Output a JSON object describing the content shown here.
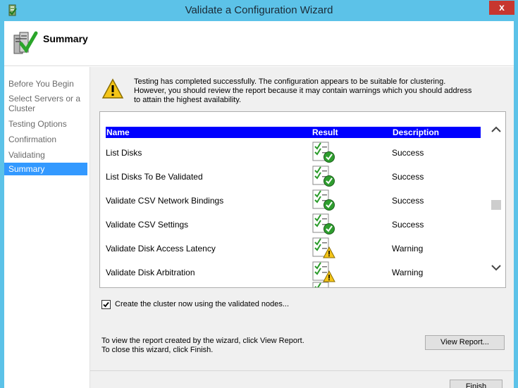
{
  "window": {
    "title": "Validate a Configuration Wizard",
    "close_label": "x"
  },
  "header": {
    "title": "Summary",
    "icon": "cluster-validation-icon"
  },
  "nav": {
    "items": [
      {
        "label": "Before You Begin"
      },
      {
        "label": "Select Servers or a Cluster"
      },
      {
        "label": "Testing Options"
      },
      {
        "label": "Confirmation"
      },
      {
        "label": "Validating"
      },
      {
        "label": "Summary",
        "active": true
      }
    ]
  },
  "info": {
    "icon": "warning-icon",
    "text_line1": "Testing has completed successfully. The configuration appears to be suitable for clustering.",
    "text_line2": "However, you should review the report because it may contain warnings which you should address",
    "text_line3": "to attain the highest availability."
  },
  "report": {
    "columns": {
      "name": "Name",
      "result": "Result",
      "description": "Description"
    },
    "rows": [
      {
        "name": "List Disks",
        "result_icon": "success-check-icon",
        "description": "Success"
      },
      {
        "name": "List Disks To Be Validated",
        "result_icon": "success-check-icon",
        "description": "Success"
      },
      {
        "name": "Validate CSV Network Bindings",
        "result_icon": "success-check-icon",
        "description": "Success"
      },
      {
        "name": "Validate CSV Settings",
        "result_icon": "success-check-icon",
        "description": "Success"
      },
      {
        "name": "Validate Disk Access Latency",
        "result_icon": "warning-check-icon",
        "description": "Warning"
      },
      {
        "name": "Validate Disk Arbitration",
        "result_icon": "warning-check-icon",
        "description": "Warning"
      }
    ]
  },
  "create_cluster": {
    "checked": true,
    "label": "Create the cluster now using the validated nodes..."
  },
  "help": {
    "line1": "To view the report created by the wizard, click View Report.",
    "line2": "To close this wizard, click Finish."
  },
  "buttons": {
    "view_report": "View Report...",
    "finish": "Finish"
  },
  "colors": {
    "title_bar": "#5cc2e8",
    "selection": "#3399ff",
    "report_header": "#0000ff",
    "close": "#c7372f"
  }
}
